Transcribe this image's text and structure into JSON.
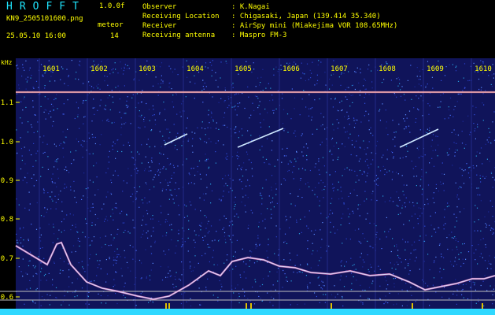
{
  "header": {
    "logo": "HROFFT",
    "version": "1.0.0f",
    "filename": "KN9_2505101600.png",
    "meteor_label": "meteor",
    "datetime": "25.05.10 16:00",
    "count": "14",
    "info": [
      {
        "key": "Observer",
        "value": ": K.Nagai"
      },
      {
        "key": "Receiving Location",
        "value": ": Chigasaki, Japan (139.414 35.340)"
      },
      {
        "key": "Receiver",
        "value": ": AirSpy mini (Miakejima VOR 108.65MHz)"
      },
      {
        "key": "Receiving antenna",
        "value": ": Maspro FM-3"
      }
    ]
  },
  "plot": {
    "unit_label": "kHz",
    "time_labels": [
      "1601",
      "1602",
      "1603",
      "1604",
      "1605",
      "1606",
      "1607",
      "1608",
      "1609",
      "1610"
    ],
    "freq_labels": [
      "1.1",
      "1.0",
      "0.9",
      "0.8",
      "0.7",
      "0.6"
    ],
    "colors": {
      "background": "#10145a",
      "text": "#ffff00",
      "grid": "#e0c000",
      "signal": "#d8e0ff",
      "baseline": "#2fd8ff"
    }
  }
}
